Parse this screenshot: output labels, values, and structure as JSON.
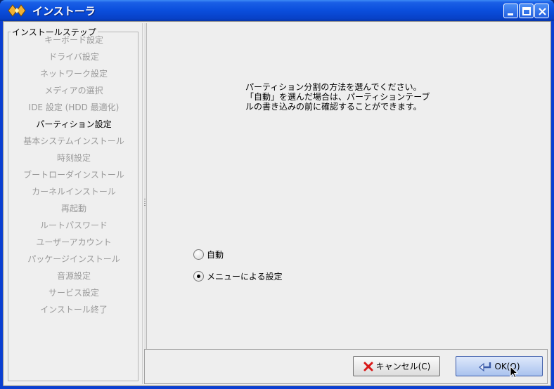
{
  "window": {
    "title": "インストーラ"
  },
  "sidebar": {
    "legend": "インストールステップ",
    "steps": [
      {
        "label": "キーボード設定",
        "active": false
      },
      {
        "label": "ドライバ設定",
        "active": false
      },
      {
        "label": "ネットワーク設定",
        "active": false
      },
      {
        "label": "メディアの選択",
        "active": false
      },
      {
        "label": "IDE 設定 (HDD 最適化)",
        "active": false
      },
      {
        "label": "パーティション設定",
        "active": true
      },
      {
        "label": "基本システムインストール",
        "active": false
      },
      {
        "label": "時刻設定",
        "active": false
      },
      {
        "label": "ブートローダインストール",
        "active": false
      },
      {
        "label": "カーネルインストール",
        "active": false
      },
      {
        "label": "再起動",
        "active": false
      },
      {
        "label": "ルートパスワード",
        "active": false
      },
      {
        "label": "ユーザーアカウント",
        "active": false
      },
      {
        "label": "パッケージインストール",
        "active": false
      },
      {
        "label": "音源設定",
        "active": false
      },
      {
        "label": "サービス設定",
        "active": false
      },
      {
        "label": "インストール終了",
        "active": false
      }
    ]
  },
  "main": {
    "description": [
      "パーティション分割の方法を選んでください。",
      "「自動」を選んだ場合は、パーティションテーブ",
      "ルの書き込みの前に確認することができます。"
    ],
    "options": [
      {
        "label": "自動",
        "checked": false
      },
      {
        "label": "メニューによる設定",
        "checked": true
      }
    ]
  },
  "buttons": {
    "cancel_label": "キャンセル(C)",
    "ok_label": "OK(O)"
  },
  "icons": {
    "app": "installer-icon",
    "minimize": "minimize-icon",
    "maximize": "maximize-icon",
    "close": "close-icon",
    "cancel": "red-x-icon",
    "ok": "enter-arrow-icon"
  },
  "colors": {
    "titlebar": "#0a4edc",
    "active_step": "#000000",
    "inactive_step": "#9a9a9a"
  }
}
